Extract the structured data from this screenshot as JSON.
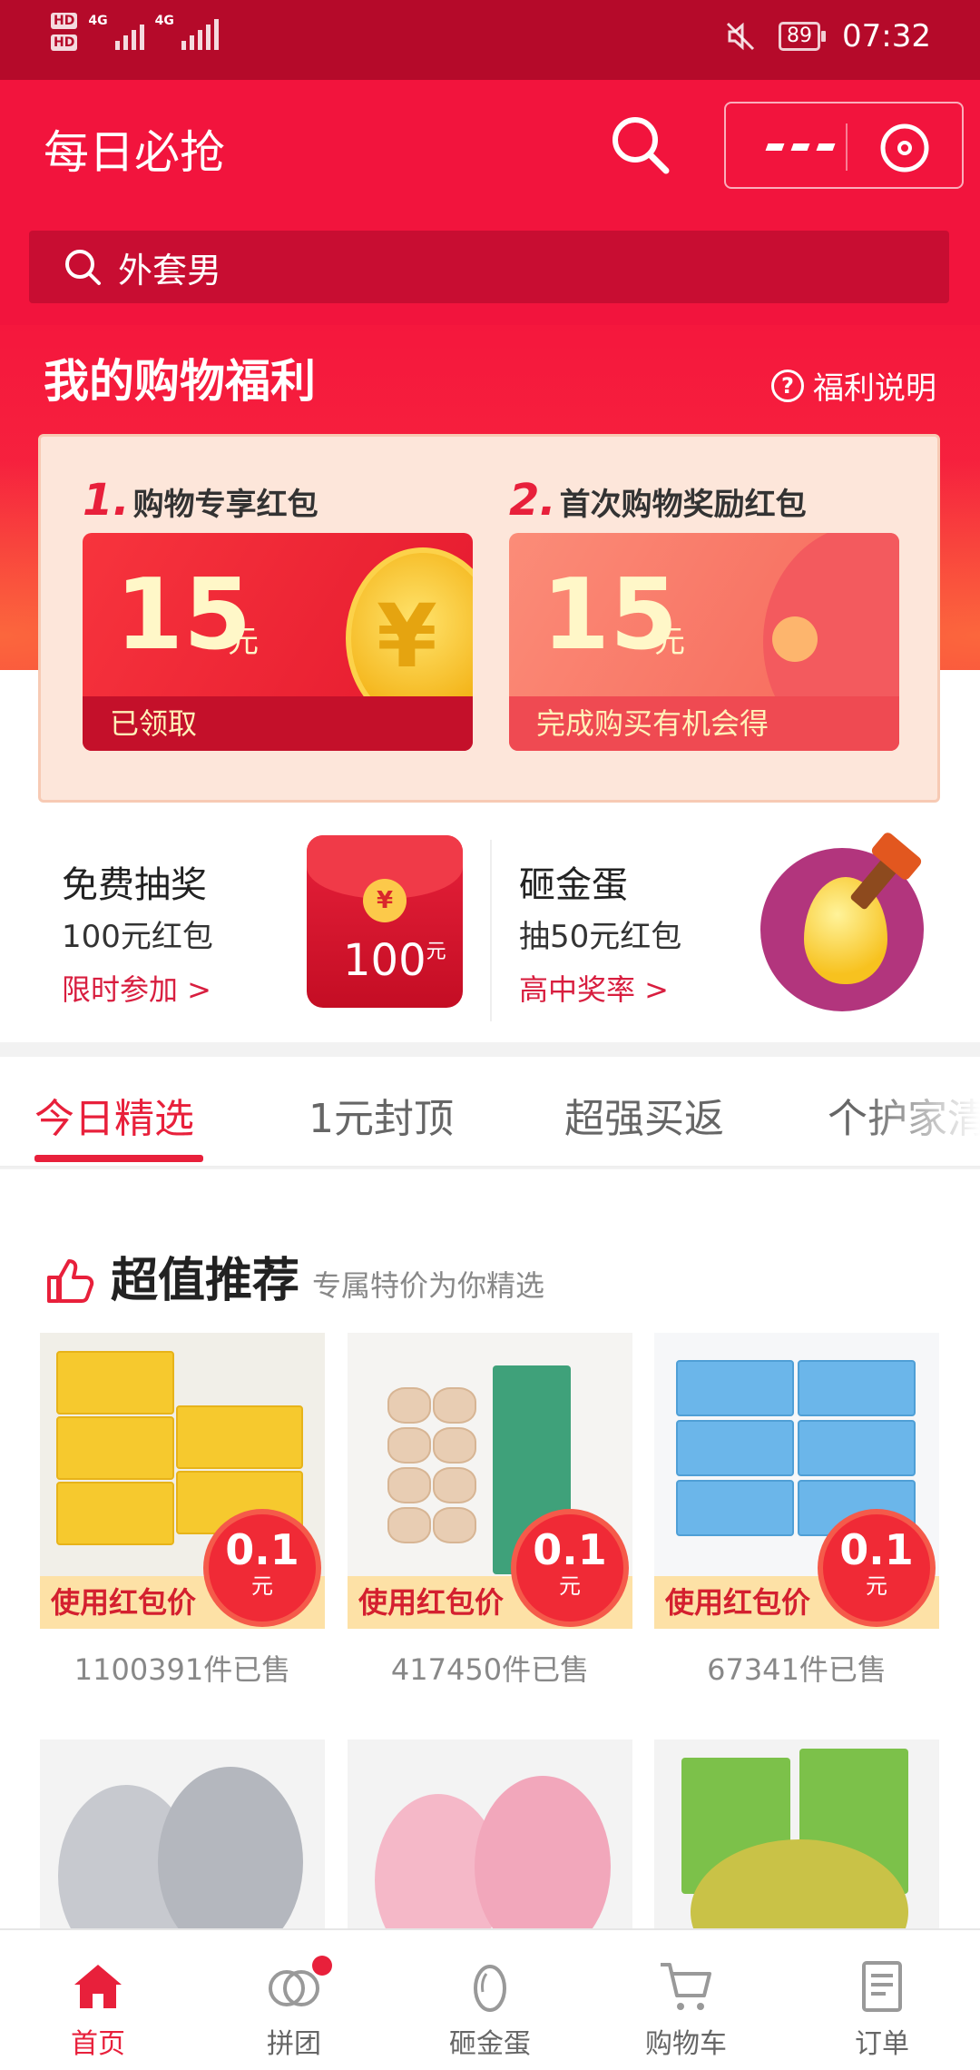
{
  "status_bar": {
    "network_1": "4G",
    "network_2": "4G",
    "battery": "89",
    "time": "07:32"
  },
  "header": {
    "title": "每日必抢",
    "search_value": "外套男"
  },
  "welfare": {
    "title": "我的购物福利",
    "help_label": "福利说明",
    "coupon_1": {
      "number": "1.",
      "label": "购物专享红包",
      "amount": "15",
      "unit": "元",
      "footer": "已领取"
    },
    "coupon_2": {
      "number": "2.",
      "label": "首次购物奖励红包",
      "amount": "15",
      "unit": "元",
      "footer": "完成购买有机会得"
    }
  },
  "promos": {
    "lottery": {
      "title": "免费抽奖",
      "subtitle": "100元红包",
      "action": "限时参加 >",
      "envelope_value": "100",
      "envelope_unit": "元"
    },
    "egg": {
      "title": "砸金蛋",
      "subtitle": "抽50元红包",
      "action": "高中奖率 >"
    }
  },
  "tabs": [
    "今日精选",
    "1元封顶",
    "超强买返",
    "个护家清"
  ],
  "recommend": {
    "title": "超值推荐",
    "subtitle": "专属特价为你精选",
    "price_label": "使用红包价",
    "price_value": "0.1",
    "price_unit": "元",
    "products": [
      {
        "sold": "1100391件已售"
      },
      {
        "sold": "417450件已售"
      },
      {
        "sold": "67341件已售"
      }
    ]
  },
  "tabbar": {
    "items": [
      {
        "label": "首页",
        "icon": "home-icon"
      },
      {
        "label": "拼团",
        "icon": "group-icon"
      },
      {
        "label": "砸金蛋",
        "icon": "egg-icon"
      },
      {
        "label": "购物车",
        "icon": "cart-icon"
      },
      {
        "label": "订单",
        "icon": "order-icon"
      }
    ],
    "active_index": 0
  },
  "colors": {
    "brand_red": "#f2143d",
    "status_bar": "#b50a2a",
    "accent": "#e8203b"
  }
}
